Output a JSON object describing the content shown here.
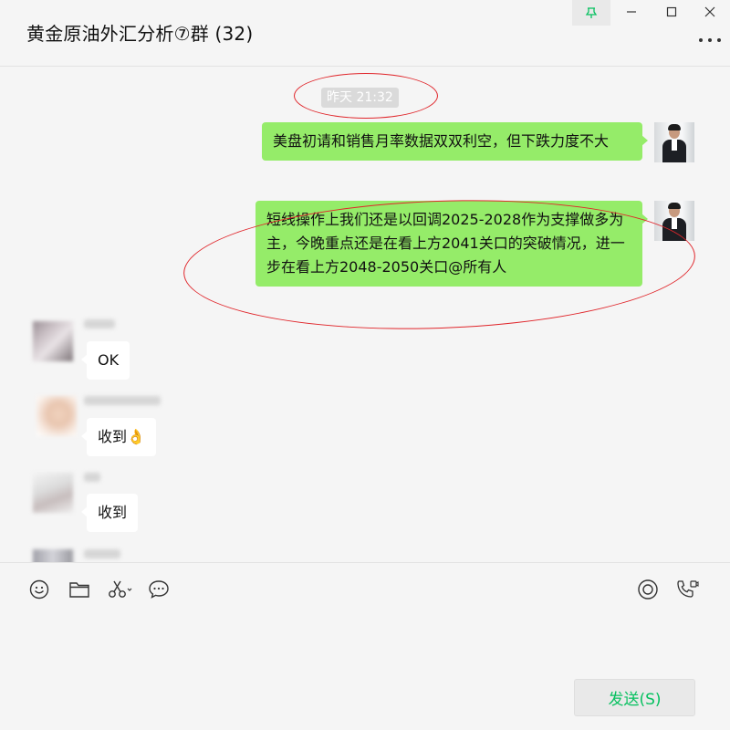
{
  "window": {
    "title": "黄金原油外汇分析⑦群 (32)"
  },
  "chat": {
    "timestamp": "昨天 21:32",
    "messages": [
      {
        "sender": "me",
        "text": "美盘初请和销售月率数据双双利空，但下跌力度不大"
      },
      {
        "sender": "me",
        "text": "短线操作上我们还是以回调2025-2028作为支撑做多为主，今晚重点还是在看上方2041关口的突破情况，进一步在看上方2048-2050关口@所有人"
      },
      {
        "sender": "other",
        "text": "OK"
      },
      {
        "sender": "other",
        "text": "收到",
        "emoji": "👌"
      },
      {
        "sender": "other",
        "text": "收到"
      }
    ]
  },
  "toolbar": {
    "icons": [
      "emoji-icon",
      "folder-icon",
      "scissors-icon",
      "chat-history-icon",
      "live-icon",
      "call-icon"
    ],
    "send_label": "发送(S)"
  },
  "colors": {
    "accent_green": "#07c160",
    "bubble_green": "#95ec69",
    "annotation_red": "#e0262b"
  }
}
